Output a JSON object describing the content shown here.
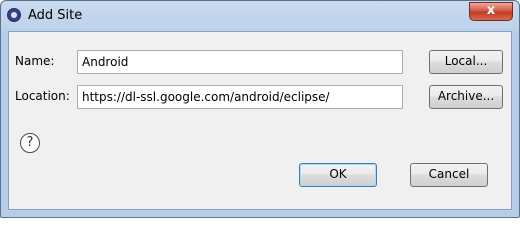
{
  "window": {
    "title": "Add Site",
    "close_glyph": "x"
  },
  "form": {
    "name_label": "Name:",
    "name_value": "Android",
    "location_label": "Location:",
    "location_value": "https://dl-ssl.google.com/android/eclipse/"
  },
  "buttons": {
    "local": "Local...",
    "archive": "Archive...",
    "ok": "OK",
    "cancel": "Cancel",
    "help": "?"
  },
  "icons": {
    "app": "eclipse-icon",
    "help": "help-icon",
    "close": "close-icon"
  }
}
